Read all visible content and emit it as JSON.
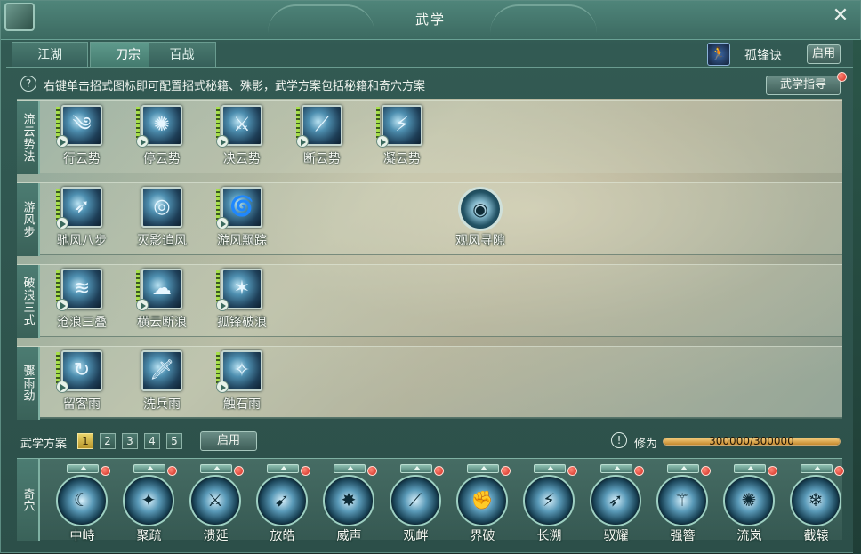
{
  "window": {
    "title": "武学"
  },
  "tabs": [
    {
      "label": "江湖"
    },
    {
      "label": "刀宗"
    },
    {
      "label": "百战"
    }
  ],
  "active_tab": "刀宗",
  "skill_header": {
    "name": "孤锋诀",
    "enable_label": "启用"
  },
  "info": {
    "text": "右键单击招式图标即可配置招式秘籍、殊影，武学方案包括秘籍和奇穴方案",
    "guide_button": "武学指导"
  },
  "groups": [
    {
      "label": "流云势法",
      "skills": [
        {
          "name": "行云势"
        },
        {
          "name": "停云势"
        },
        {
          "name": "决云势"
        },
        {
          "name": "断云势"
        },
        {
          "name": "凝云势"
        }
      ]
    },
    {
      "label": "游风步",
      "skills": [
        {
          "name": "驰风八步"
        },
        {
          "name": "灭影追风"
        },
        {
          "name": "游风飘踪"
        },
        {
          "name": "观风寻隙"
        }
      ]
    },
    {
      "label": "破浪三式",
      "skills": [
        {
          "name": "沧浪三叠"
        },
        {
          "name": "横云断浪"
        },
        {
          "name": "孤锋破浪"
        }
      ]
    },
    {
      "label": "骤雨劲",
      "skills": [
        {
          "name": "留客雨"
        },
        {
          "name": "洗兵雨"
        },
        {
          "name": "触石雨"
        }
      ]
    }
  ],
  "scheme": {
    "label": "武学方案",
    "numbers": [
      "1",
      "2",
      "3",
      "4",
      "5"
    ],
    "active": "1",
    "enable_label": "启用"
  },
  "xiuwei": {
    "label": "修为",
    "value_text": "300000/300000",
    "fill_fraction": 1.0
  },
  "qixue": {
    "label": "奇穴",
    "items": [
      {
        "name": "中峙"
      },
      {
        "name": "聚疏"
      },
      {
        "name": "溃延"
      },
      {
        "name": "放皓"
      },
      {
        "name": "威声"
      },
      {
        "name": "观衅"
      },
      {
        "name": "界破"
      },
      {
        "name": "长溯"
      },
      {
        "name": "驭耀"
      },
      {
        "name": "强簪"
      },
      {
        "name": "流岚"
      },
      {
        "name": "截辕"
      }
    ]
  },
  "colors": {
    "accent": "#6a9c90",
    "highlight": "#e9d46a",
    "notification": "#d0281c",
    "xiuwei_fill": "#f1c878"
  }
}
